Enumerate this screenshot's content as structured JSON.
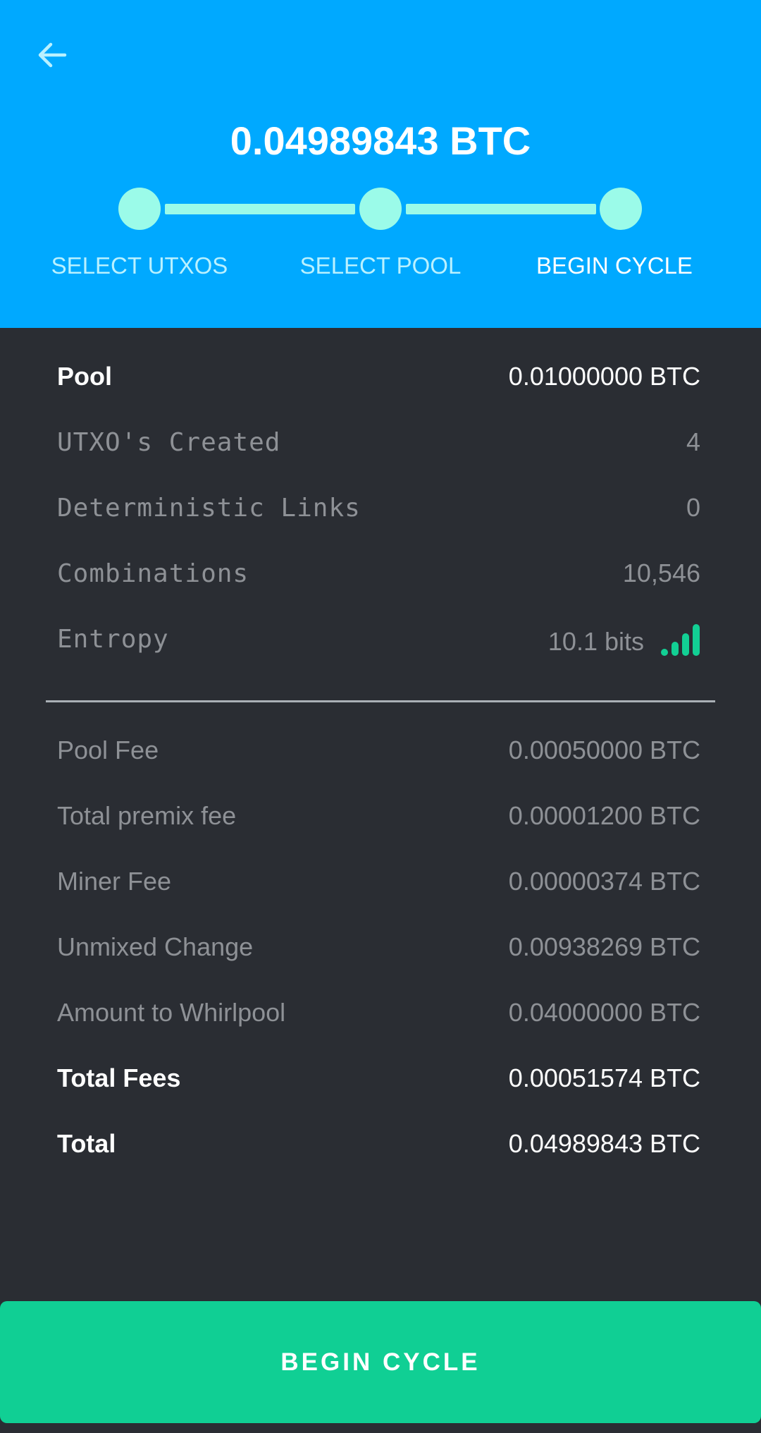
{
  "header": {
    "amount": "0.04989843 BTC",
    "steps": [
      {
        "label": "SELECT UTXOS"
      },
      {
        "label": "SELECT POOL"
      },
      {
        "label": "BEGIN CYCLE"
      }
    ],
    "active_step_index": 2
  },
  "details": {
    "pool": {
      "label": "Pool",
      "value": "0.01000000 BTC"
    },
    "utxos_created": {
      "label": "UTXO's Created",
      "value": "4"
    },
    "deterministic_links": {
      "label": "Deterministic Links",
      "value": "0"
    },
    "combinations": {
      "label": "Combinations",
      "value": "10,546"
    },
    "entropy": {
      "label": "Entropy",
      "value": "10.1 bits",
      "signal_level": 4,
      "signal_max": 4
    }
  },
  "fees": {
    "pool_fee": {
      "label": "Pool Fee",
      "value": "0.00050000 BTC"
    },
    "premix_fee": {
      "label": "Total premix fee",
      "value": "0.00001200 BTC"
    },
    "miner_fee": {
      "label": "Miner Fee",
      "value": "0.00000374 BTC"
    },
    "unmixed_change": {
      "label": "Unmixed Change",
      "value": "0.00938269 BTC"
    },
    "amount_to_whirlpool": {
      "label": "Amount to Whirlpool",
      "value": "0.04000000 BTC"
    },
    "total_fees": {
      "label": "Total Fees",
      "value": "0.00051574 BTC"
    },
    "total": {
      "label": "Total",
      "value": "0.04989843 BTC"
    }
  },
  "actions": {
    "begin_cycle_label": "BEGIN CYCLE"
  },
  "colors": {
    "header_bg": "#00a9ff",
    "body_bg": "#2a2d33",
    "accent_green": "#10cf94",
    "step_color": "#9bfbe9"
  },
  "icons": {
    "back": "arrow-left-icon",
    "entropy": "signal-bars-icon"
  }
}
